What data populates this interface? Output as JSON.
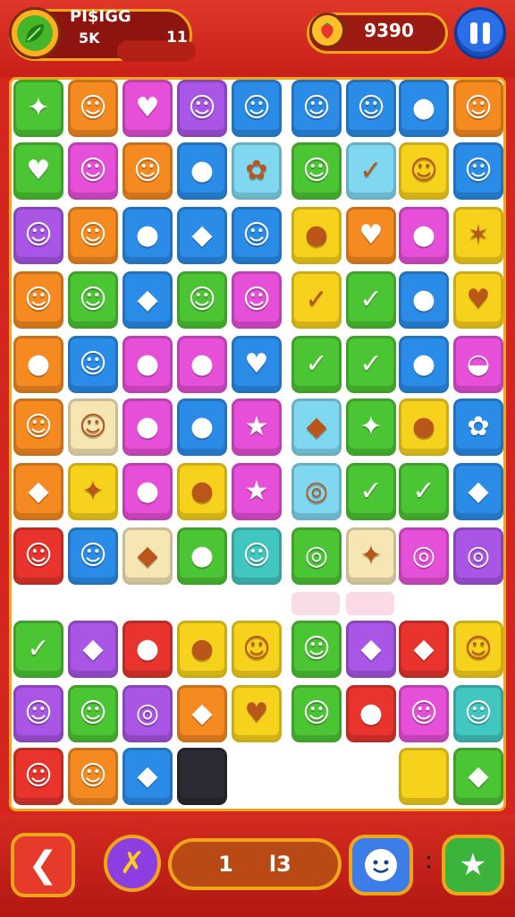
{
  "header": {
    "level_title": "PI$IGG",
    "level_sub": "5K",
    "level_number": "11",
    "score": "9390",
    "leaf_icon": "leaf-icon",
    "strawberry_icon": "strawberry-icon",
    "pause_icon": "pause-icon"
  },
  "colors": {
    "green": "#4cc534",
    "orange": "#f58a20",
    "pink": "#e64fd8",
    "purple": "#a955e6",
    "blue": "#2b8ce8",
    "red": "#e8342c",
    "yellow": "#f7d21c",
    "lightblue": "#7fd8f0",
    "cream": "#f6e6b4",
    "teal": "#42c6c0",
    "dark": "#2a2b33",
    "white": "#ffffff"
  },
  "board": {
    "rows": [
      [
        {
          "color": "green",
          "glyph": "✦",
          "icon": "leaf-candy-icon"
        },
        {
          "color": "orange",
          "glyph": "☺",
          "icon": "face-candy-icon"
        },
        {
          "color": "pink",
          "glyph": "♥",
          "icon": "shield-candy-icon"
        },
        {
          "color": "purple",
          "glyph": "☺",
          "icon": "cat-candy-icon"
        },
        {
          "color": "blue",
          "glyph": "☺",
          "icon": "cat-candy-icon"
        },
        {
          "color": "blue",
          "glyph": "☺",
          "icon": "cat-candy-icon"
        },
        {
          "color": "blue",
          "glyph": "☺",
          "icon": "cat-candy-icon"
        },
        {
          "color": "blue",
          "glyph": "●",
          "icon": "drop-candy-icon"
        },
        {
          "color": "orange",
          "glyph": "☺",
          "icon": "cat-candy-icon"
        }
      ],
      [
        {
          "color": "green",
          "glyph": "♥",
          "icon": "heart-candy-icon"
        },
        {
          "color": "pink",
          "glyph": "☺",
          "icon": "cat-candy-icon"
        },
        {
          "color": "orange",
          "glyph": "☺",
          "icon": "chestnut-candy-icon"
        },
        {
          "color": "blue",
          "glyph": "●",
          "icon": "flame-candy-icon"
        },
        {
          "color": "lightblue",
          "glyph": "✿",
          "icon": "moose-candy-icon"
        },
        {
          "color": "green",
          "glyph": "☺",
          "icon": "cat-candy-icon"
        },
        {
          "color": "lightblue",
          "glyph": "✓",
          "icon": "check-candy-icon"
        },
        {
          "color": "yellow",
          "glyph": "☺",
          "icon": "chestnut-candy-icon"
        },
        {
          "color": "blue",
          "glyph": "☺",
          "icon": "cat-candy-icon"
        }
      ],
      [
        {
          "color": "purple",
          "glyph": "☺",
          "icon": "cat-candy-icon"
        },
        {
          "color": "orange",
          "glyph": "☺",
          "icon": "face-candy-icon"
        },
        {
          "color": "blue",
          "glyph": "●",
          "icon": "drop-candy-icon"
        },
        {
          "color": "blue",
          "glyph": "◆",
          "icon": "leaf-candy-icon"
        },
        {
          "color": "blue",
          "glyph": "☺",
          "icon": "cat-candy-icon"
        },
        {
          "color": "yellow",
          "glyph": "●",
          "icon": "lemon-candy-icon"
        },
        {
          "color": "orange",
          "glyph": "♥",
          "icon": "apple-candy-icon"
        },
        {
          "color": "pink",
          "glyph": "●",
          "icon": "drop-candy-icon"
        },
        {
          "color": "yellow",
          "glyph": "✶",
          "icon": "dragonfly-candy-icon"
        }
      ],
      [
        {
          "color": "orange",
          "glyph": "☺",
          "icon": "cat-candy-icon"
        },
        {
          "color": "green",
          "glyph": "☺",
          "icon": "cat-candy-icon"
        },
        {
          "color": "blue",
          "glyph": "◆",
          "icon": "gem-candy-icon"
        },
        {
          "color": "green",
          "glyph": "☺",
          "icon": "face-candy-icon"
        },
        {
          "color": "pink",
          "glyph": "☺",
          "icon": "monkey-candy-icon"
        },
        {
          "color": "yellow",
          "glyph": "✓",
          "icon": "check-candy-icon"
        },
        {
          "color": "green",
          "glyph": "✓",
          "icon": "check-candy-icon"
        },
        {
          "color": "blue",
          "glyph": "●",
          "icon": "drop-candy-icon"
        },
        {
          "color": "yellow",
          "glyph": "♥",
          "icon": "heart-candy-icon"
        }
      ],
      [
        {
          "color": "orange",
          "glyph": "●",
          "icon": "orange-candy-icon"
        },
        {
          "color": "blue",
          "glyph": "☺",
          "icon": "cat-candy-icon"
        },
        {
          "color": "pink",
          "glyph": "●",
          "icon": "drop-candy-icon"
        },
        {
          "color": "pink",
          "glyph": "●",
          "icon": "drop-candy-icon"
        },
        {
          "color": "blue",
          "glyph": "♥",
          "icon": "heart-candy-icon"
        },
        {
          "color": "green",
          "glyph": "✓",
          "icon": "check-candy-icon"
        },
        {
          "color": "green",
          "glyph": "✓",
          "icon": "check-candy-icon"
        },
        {
          "color": "blue",
          "glyph": "●",
          "icon": "drop-candy-icon"
        },
        {
          "color": "pink",
          "glyph": "◒",
          "icon": "planet-candy-icon"
        }
      ],
      [
        {
          "color": "orange",
          "glyph": "☺",
          "icon": "face-candy-icon"
        },
        {
          "color": "cream",
          "glyph": "☺",
          "icon": "chestnut-candy-icon"
        },
        {
          "color": "pink",
          "glyph": "●",
          "icon": "drop-candy-icon"
        },
        {
          "color": "blue",
          "glyph": "●",
          "icon": "drop-candy-icon"
        },
        {
          "color": "pink",
          "glyph": "★",
          "icon": "star-candy-icon"
        },
        {
          "color": "lightblue",
          "glyph": "◆",
          "icon": "crystal-candy-icon"
        },
        {
          "color": "green",
          "glyph": "✦",
          "icon": "bear-candy-icon"
        },
        {
          "color": "yellow",
          "glyph": "●",
          "icon": "ball-candy-icon"
        },
        {
          "color": "blue",
          "glyph": "✿",
          "icon": "flower-candy-icon"
        }
      ],
      [
        {
          "color": "orange",
          "glyph": "◆",
          "icon": "leaf-candy-icon"
        },
        {
          "color": "yellow",
          "glyph": "✦",
          "icon": "leaf-candy-icon"
        },
        {
          "color": "pink",
          "glyph": "●",
          "icon": "ball-candy-icon"
        },
        {
          "color": "yellow",
          "glyph": "●",
          "icon": "drop-candy-icon"
        },
        {
          "color": "pink",
          "glyph": "★",
          "icon": "star-candy-icon"
        },
        {
          "color": "lightblue",
          "glyph": "◎",
          "icon": "donut-candy-icon"
        },
        {
          "color": "green",
          "glyph": "✓",
          "icon": "check-candy-icon"
        },
        {
          "color": "green",
          "glyph": "✓",
          "icon": "check-candy-icon"
        },
        {
          "color": "blue",
          "glyph": "◆",
          "icon": "leaf-candy-icon"
        }
      ],
      [
        {
          "color": "red",
          "glyph": "☺",
          "icon": "face-candy-icon"
        },
        {
          "color": "blue",
          "glyph": "☺",
          "icon": "face-candy-icon"
        },
        {
          "color": "cream",
          "glyph": "◆",
          "icon": "leaf-candy-icon"
        },
        {
          "color": "green",
          "glyph": "●",
          "icon": "ball-candy-icon"
        },
        {
          "color": "teal",
          "glyph": "☺",
          "icon": "cat-candy-icon"
        },
        {
          "color": "green",
          "glyph": "◎",
          "icon": "ring-candy-icon"
        },
        {
          "color": "cream",
          "glyph": "✦",
          "icon": "bell-candy-icon"
        },
        {
          "color": "pink",
          "glyph": "◎",
          "icon": "swirl-candy-icon"
        },
        {
          "color": "purple",
          "glyph": "◎",
          "icon": "swirl-candy-icon"
        }
      ],
      [
        {
          "color": "green",
          "glyph": "✓",
          "icon": "check-candy-icon"
        },
        {
          "color": "purple",
          "glyph": "◆",
          "icon": "leaf-candy-icon"
        },
        {
          "color": "red",
          "glyph": "●",
          "icon": "apple-candy-icon"
        },
        {
          "color": "yellow",
          "glyph": "●",
          "icon": "drop-candy-icon"
        },
        {
          "color": "yellow",
          "glyph": "☺",
          "icon": "face-candy-icon"
        },
        {
          "color": "green",
          "glyph": "☺",
          "icon": "cat-candy-icon"
        },
        {
          "color": "purple",
          "glyph": "◆",
          "icon": "leaf-candy-icon"
        },
        {
          "color": "red",
          "glyph": "◆",
          "icon": "leaf-candy-icon"
        },
        {
          "color": "yellow",
          "glyph": "☺",
          "icon": "face-candy-icon"
        }
      ],
      [
        {
          "color": "purple",
          "glyph": "☺",
          "icon": "cat-candy-icon"
        },
        {
          "color": "green",
          "glyph": "☺",
          "icon": "cat-candy-icon"
        },
        {
          "color": "purple",
          "glyph": "◎",
          "icon": "ring-candy-icon"
        },
        {
          "color": "orange",
          "glyph": "◆",
          "icon": "leaf-candy-icon"
        },
        {
          "color": "yellow",
          "glyph": "♥",
          "icon": "heart-candy-icon"
        },
        {
          "color": "green",
          "glyph": "☺",
          "icon": "face-candy-icon"
        },
        {
          "color": "red",
          "glyph": "●",
          "icon": "orange-candy-icon"
        },
        {
          "color": "pink",
          "glyph": "☺",
          "icon": "cat-candy-icon"
        },
        {
          "color": "teal",
          "glyph": "☺",
          "icon": "face-candy-icon"
        }
      ],
      [
        {
          "color": "red",
          "glyph": "☺",
          "icon": "cat-candy-icon"
        },
        {
          "color": "orange",
          "glyph": "☺",
          "icon": "cat-candy-icon"
        },
        {
          "color": "blue",
          "glyph": "◆",
          "icon": "crystal-candy-icon"
        },
        {
          "color": "dark",
          "glyph": "",
          "icon": "blocker-tile"
        },
        {
          "color": "white",
          "glyph": "",
          "icon": "empty-cell"
        },
        {
          "color": "white",
          "glyph": "",
          "icon": "empty-cell"
        },
        {
          "color": "white",
          "glyph": "",
          "icon": "empty-cell"
        },
        {
          "color": "yellow",
          "glyph": "",
          "icon": "plain-yellow-tile"
        },
        {
          "color": "green",
          "glyph": "◆",
          "icon": "leaf-candy-icon"
        }
      ]
    ]
  },
  "footer": {
    "back_icon": "back-icon",
    "wand_icon": "magic-wand-icon",
    "moves_left": "1",
    "moves_right": "l3",
    "face_icon": "smiley-icon",
    "star_icon": "star-icon"
  }
}
